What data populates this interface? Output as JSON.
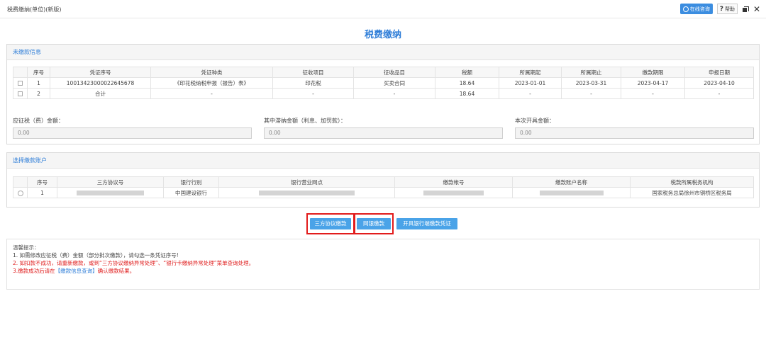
{
  "window": {
    "title": "税费缴纳(单位)(新版)",
    "online_btn": "在线咨询",
    "help_btn": "帮助"
  },
  "page_title": "税费缴纳",
  "unpaid": {
    "header": "未缴款信息",
    "columns": [
      "序号",
      "凭证序号",
      "凭证种类",
      "征收项目",
      "征收品目",
      "税额",
      "所属期起",
      "所属期止",
      "缴款期限",
      "申报日期"
    ],
    "rows": [
      {
        "no": "1",
        "voucher_no": "10013423000022645678",
        "voucher_type": "《印花税纳税申报（报告）表》",
        "item": "印花税",
        "sub_item": "买卖合同",
        "amount": "18.64",
        "period_start": "2023-01-01",
        "period_end": "2023-03-31",
        "deadline": "2023-04-17",
        "declare_date": "2023-04-10"
      },
      {
        "no": "2",
        "voucher_no": "合计",
        "voucher_type": "-",
        "item": "-",
        "sub_item": "-",
        "amount": "18.64",
        "period_start": "-",
        "period_end": "-",
        "deadline": "-",
        "declare_date": "-"
      }
    ],
    "fields": {
      "payable_label": "应征税（费）金额：",
      "payable_value": "0.00",
      "late_label": "其中滞纳金额（利息、加罚款）：",
      "late_value": "0.00",
      "issue_label": "本次开具金额：",
      "issue_value": "0.00"
    }
  },
  "account": {
    "header": "选择缴款账户",
    "columns": [
      "序号",
      "三方协议号",
      "银行行别",
      "银行营业网点",
      "缴款帐号",
      "缴款账户名称",
      "税款所属税务机构"
    ],
    "rows": [
      {
        "no": "1",
        "bank": "中国建设银行",
        "tax_office": "国家税务总局徐州市铜桥区税务局"
      }
    ]
  },
  "actions": {
    "tripartite_pay": "三方协议缴款",
    "online_pay": "网银缴款",
    "bank_voucher": "开具银行端缴款凭证"
  },
  "tips": {
    "title": "温馨提示：",
    "line1": "1. 如需修改应征税（费）金额（部分批次缴款），请勾选一条凭证序号!",
    "line2": "2. 如扣款不成功，请重新缴款，或到“三方协议缴纳异常处理”、“银行卡缴纳异常处理”菜单查询处理。",
    "line3_a": "3.缴款成功后请在",
    "line3_link": "【缴款信息查询】",
    "line3_b": "确认缴款结果。"
  },
  "colors": {
    "accent": "#2f7ed8",
    "button": "#4aa3e8",
    "highlight": "#e21b1b",
    "warning_text": "#e02020"
  }
}
